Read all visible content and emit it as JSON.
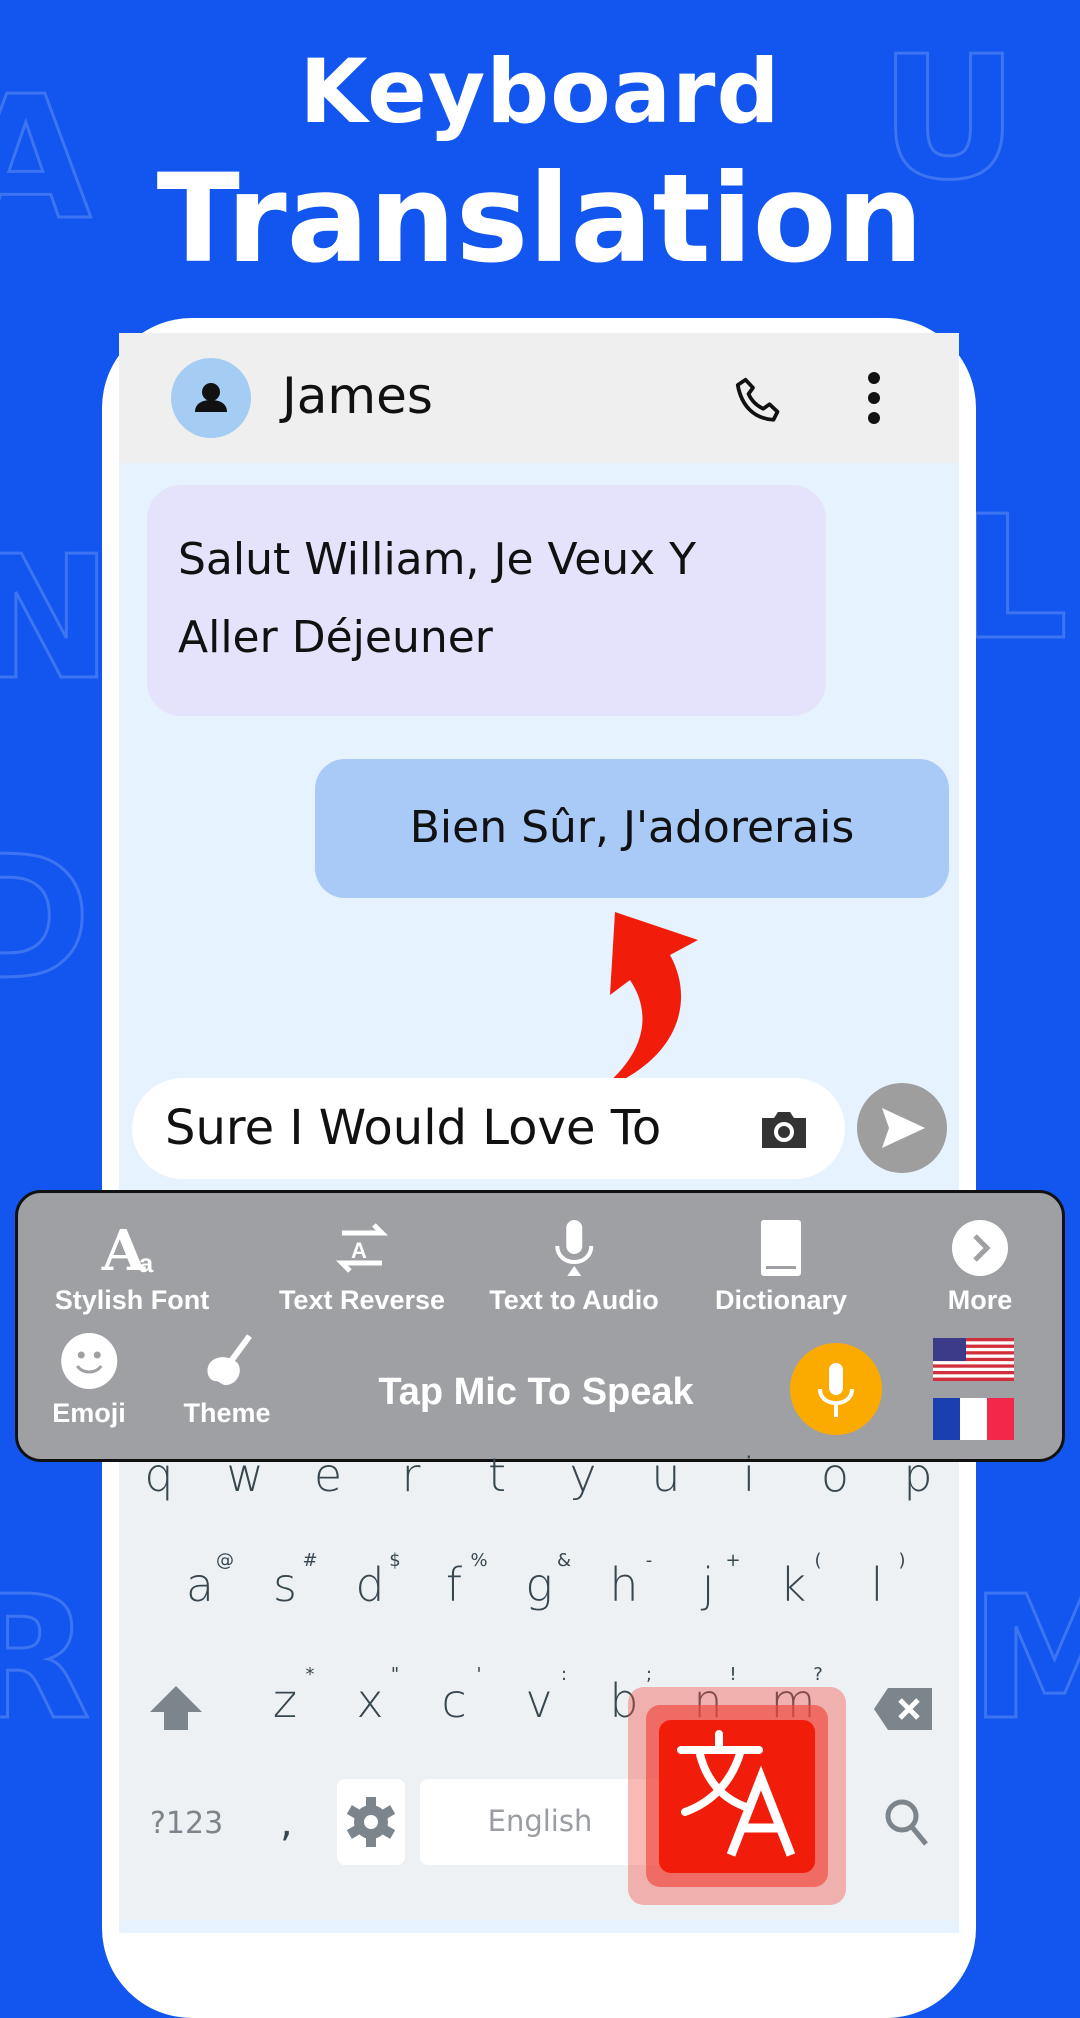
{
  "promo": {
    "line1": "Keyboard",
    "line2": "Translation"
  },
  "header": {
    "contact_name": "James"
  },
  "messages": [
    {
      "lines": [
        "Salut William, Je Veux Y",
        "Aller Déjeuner"
      ],
      "side": "received"
    },
    {
      "lines": [
        "Bien Sûr, J'adorerais"
      ],
      "side": "sent"
    }
  ],
  "input": {
    "value": "Sure I Would Love To"
  },
  "toolbar": {
    "tools": [
      {
        "label": "Stylish Font",
        "icon": "font-icon"
      },
      {
        "label": "Text Reverse",
        "icon": "reverse-icon"
      },
      {
        "label": "Text to Audio",
        "icon": "mic-icon"
      },
      {
        "label": "Dictionary",
        "icon": "book-icon"
      },
      {
        "label": "More",
        "icon": "chevron-right-icon"
      }
    ],
    "emoji_label": "Emoji",
    "theme_label": "Theme",
    "speak_label": "Tap Mic To Speak",
    "source_flag": "US",
    "target_flag": "FR"
  },
  "keyboard": {
    "row1": [
      "q",
      "w",
      "e",
      "r",
      "t",
      "y",
      "u",
      "i",
      "o",
      "p"
    ],
    "row2": [
      "a",
      "s",
      "d",
      "f",
      "g",
      "h",
      "j",
      "k",
      "l"
    ],
    "row2_sup": [
      "@",
      "#",
      "$",
      "%",
      "&",
      "-",
      "+",
      "(",
      ")"
    ],
    "row3": [
      "z",
      "x",
      "c",
      "v",
      "b",
      "n",
      "m"
    ],
    "row3_sup": [
      "*",
      "\"",
      "'",
      ":",
      ";",
      "!",
      "?"
    ],
    "symbols_label": "?123",
    "comma": ",",
    "space_label": "English"
  },
  "colors": {
    "background": "#1256ef",
    "accent_red": "#f21c0a",
    "mic_orange": "#fbab00",
    "toolbar": "#9ea0a4"
  }
}
